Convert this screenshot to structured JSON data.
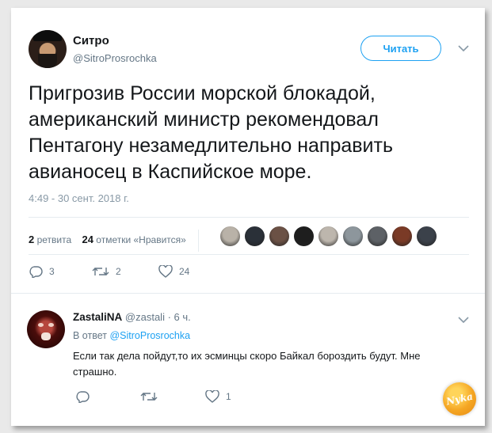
{
  "tweet": {
    "author_name": "Ситро",
    "author_handle": "@SitroProsrochka",
    "follow_label": "Читать",
    "text": "Пригрозив России морской блокадой, американский министр рекомендовал Пентагону незамедлительно направить авианосец в Каспийское море.",
    "timestamp": "4:49 - 30 сент. 2018 г.",
    "stats": {
      "retweets_count": "2",
      "retweets_label": "ретвита",
      "likes_count": "24",
      "likes_label": "отметки «Нравится»"
    },
    "likers_colors": [
      "#b9b2a8",
      "#2a3038",
      "#6b5145",
      "#1e1e1e",
      "#bdb6ad",
      "#8d969c",
      "#5d6166",
      "#7a3a26",
      "#3b414a"
    ],
    "actions": {
      "reply_count": "3",
      "retweet_count": "2",
      "like_count": "24"
    }
  },
  "reply": {
    "author_name": "ZastaliNA",
    "author_handle": "@zastali",
    "time": "· 6 ч.",
    "in_reply_prefix": "В ответ",
    "in_reply_handle": "@SitroProsrochka",
    "text": "Если так дела пойдут,то их эсминцы скоро Байкал бороздить будут. Мне страшно.",
    "actions": {
      "reply_count": "",
      "retweet_count": "",
      "like_count": "1"
    }
  },
  "watermark": {
    "text": "Nyka"
  },
  "colors": {
    "accent": "#1da1f2",
    "muted": "#657786",
    "text": "#14171a"
  }
}
